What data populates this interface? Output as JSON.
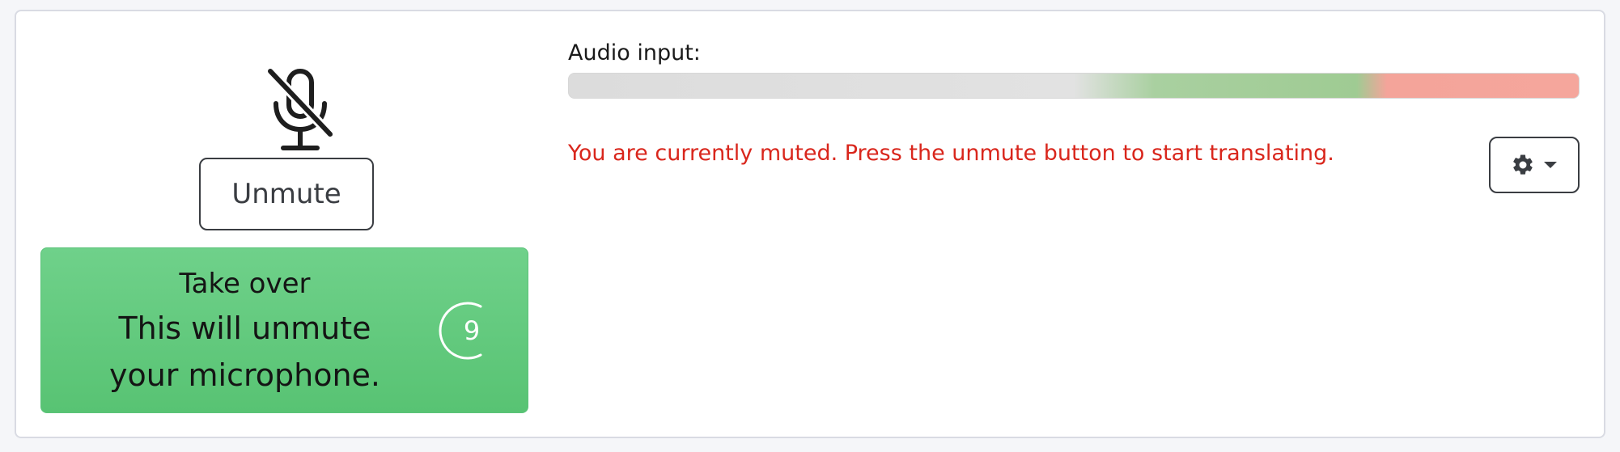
{
  "audio": {
    "label": "Audio input:",
    "level": 0
  },
  "controls": {
    "mic_icon": "microphone-off-icon",
    "unmute_label": "Unmute",
    "takeover_title": "Take over",
    "takeover_subtitle": "This will unmute your microphone.",
    "countdown_value": "9"
  },
  "status": {
    "message": "You are currently muted. Press the unmute button to start translating."
  },
  "settings": {
    "icon": "gear-icon",
    "dropdown_icon": "caret-down-icon"
  },
  "colors": {
    "takeover_green": "#5ec878",
    "muted_message_red": "#d9261c",
    "meter_green": "#9fcb93",
    "meter_red": "#f5a69c"
  }
}
